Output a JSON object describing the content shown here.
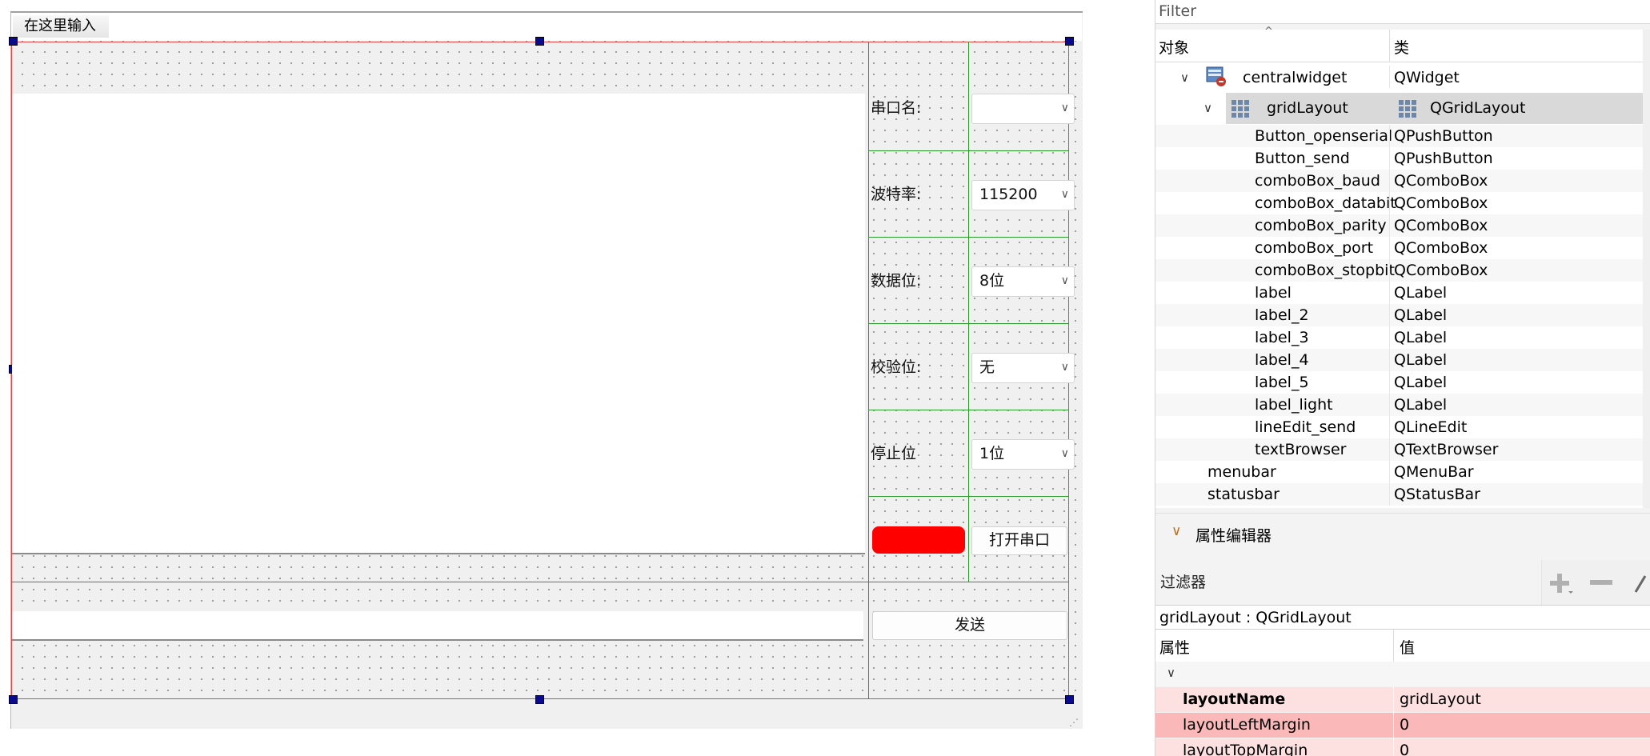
{
  "designer": {
    "menubar_placeholder": "在这里输入",
    "labels": [
      "串口名:",
      "波特率:",
      "数据位:",
      "校验位:",
      "停止位"
    ],
    "combos": [
      {
        "name": "comboBox_port",
        "value": ""
      },
      {
        "name": "comboBox_baud",
        "value": "115200"
      },
      {
        "name": "comboBox_databit",
        "value": "8位"
      },
      {
        "name": "comboBox_parity",
        "value": "无"
      },
      {
        "name": "comboBox_stopbit",
        "value": "1位"
      }
    ],
    "open_serial_button": "打开串口",
    "send_button": "发送",
    "light_color": "#ff0000",
    "layout_outline_color": "#e04848",
    "grid_line_color": "#2e9a2e"
  },
  "object_inspector": {
    "filter_placeholder": "Filter",
    "col_object": "对象",
    "col_class": "类",
    "rows": [
      {
        "name": "centralwidget",
        "class": "QWidget"
      },
      {
        "name": "gridLayout",
        "class": "QGridLayout"
      },
      {
        "name": "Button_openserial",
        "class": "QPushButton"
      },
      {
        "name": "Button_send",
        "class": "QPushButton"
      },
      {
        "name": "comboBox_baud",
        "class": "QComboBox"
      },
      {
        "name": "comboBox_databit",
        "class": "QComboBox"
      },
      {
        "name": "comboBox_parity",
        "class": "QComboBox"
      },
      {
        "name": "comboBox_port",
        "class": "QComboBox"
      },
      {
        "name": "comboBox_stopbit",
        "class": "QComboBox"
      },
      {
        "name": "label",
        "class": "QLabel"
      },
      {
        "name": "label_2",
        "class": "QLabel"
      },
      {
        "name": "label_3",
        "class": "QLabel"
      },
      {
        "name": "label_4",
        "class": "QLabel"
      },
      {
        "name": "label_5",
        "class": "QLabel"
      },
      {
        "name": "label_light",
        "class": "QLabel"
      },
      {
        "name": "lineEdit_send",
        "class": "QLineEdit"
      },
      {
        "name": "textBrowser",
        "class": "QTextBrowser"
      },
      {
        "name": "menubar",
        "class": "QMenuBar"
      },
      {
        "name": "statusbar",
        "class": "QStatusBar"
      }
    ]
  },
  "property_editor": {
    "title": "属性编辑器",
    "filter_placeholder": "过滤器",
    "object_line": "gridLayout : QGridLayout",
    "col_property": "属性",
    "col_value": "值",
    "rows": [
      {
        "name": "layoutName",
        "value": "gridLayout",
        "color": "#fde0e0",
        "bold": true
      },
      {
        "name": "layoutLeftMargin",
        "value": "0",
        "color": "#fbb8b8",
        "bold": false
      },
      {
        "name": "layoutTopMargin",
        "value": "0",
        "color": "#fde0e0",
        "bold": false
      }
    ]
  }
}
